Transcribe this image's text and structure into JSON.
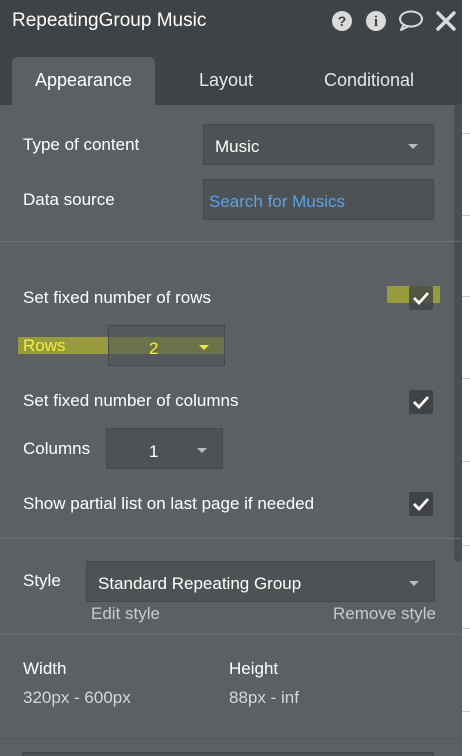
{
  "titlebar": {
    "title": "RepeatingGroup Music",
    "icons": [
      "help-icon",
      "info-icon",
      "comment-icon",
      "close-icon"
    ]
  },
  "tabs": [
    {
      "label": "Appearance",
      "active": true
    },
    {
      "label": "Layout",
      "active": false
    },
    {
      "label": "Conditional",
      "active": false
    }
  ],
  "content": {
    "type_label": "Type of content",
    "type_value": "Music",
    "source_label": "Data source",
    "source_value": "Search for Musics",
    "fixed_rows_label": "Set fixed number of rows",
    "fixed_rows_checked": true,
    "rows_label": "Rows",
    "rows_value": "2",
    "fixed_cols_label": "Set fixed number of columns",
    "fixed_cols_checked": true,
    "cols_label": "Columns",
    "cols_value": "1",
    "partial_label": "Show partial list on last page if needed",
    "partial_checked": true
  },
  "style": {
    "label": "Style",
    "value": "Standard Repeating Group",
    "edit": "Edit style",
    "remove": "Remove style"
  },
  "dimensions": {
    "width_label": "Width",
    "width_value": "320px - 600px",
    "height_label": "Height",
    "height_value": "88px - inf"
  },
  "colors": {
    "panel_bg": "#5b6064",
    "titlebar_bg": "#3f4346",
    "link": "#5ba3e6",
    "highlight": "#cbcb1f"
  }
}
